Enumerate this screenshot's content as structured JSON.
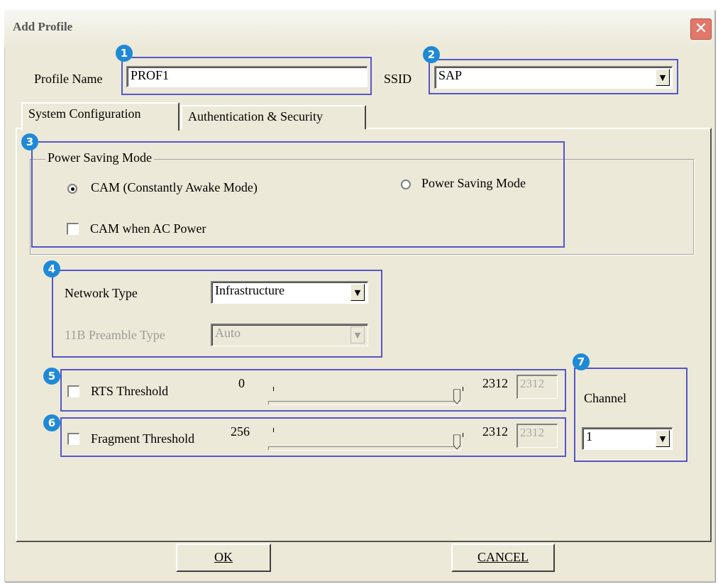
{
  "window": {
    "title": "Add Profile"
  },
  "profile": {
    "name_label": "Profile Name",
    "name_value": "PROF1"
  },
  "ssid": {
    "label": "SSID",
    "value": "SAP"
  },
  "tabs": [
    {
      "label": "System Configuration",
      "selected": true
    },
    {
      "label": "Authentication & Security",
      "selected": false
    }
  ],
  "power_saving": {
    "group_title": "Power Saving Mode",
    "option_cam": "CAM (Constantly Awake Mode)",
    "option_psm": "Power Saving Mode",
    "selected": "cam",
    "cam_ac_label": "CAM when AC Power",
    "cam_ac_checked": false
  },
  "network": {
    "type_label": "Network Type",
    "type_value": "Infrastructure",
    "preamble_label": "11B Preamble Type",
    "preamble_value": "Auto"
  },
  "rts": {
    "label": "RTS Threshold",
    "checked": false,
    "min": "0",
    "max": "2312",
    "value": "2312",
    "level": 1.0
  },
  "fragment": {
    "label": "Fragment Threshold",
    "checked": false,
    "min": "256",
    "max": "2312",
    "value": "2312",
    "level": 1.0
  },
  "channel": {
    "label": "Channel",
    "value": "1"
  },
  "buttons": {
    "ok": "OK",
    "cancel": "CANCEL"
  },
  "badges": [
    "1",
    "2",
    "3",
    "4",
    "5",
    "6",
    "7"
  ],
  "colors": {
    "highlight": "#5656c8",
    "badge": "#1e8ad6",
    "dialog_bg": "#ece9d8"
  }
}
